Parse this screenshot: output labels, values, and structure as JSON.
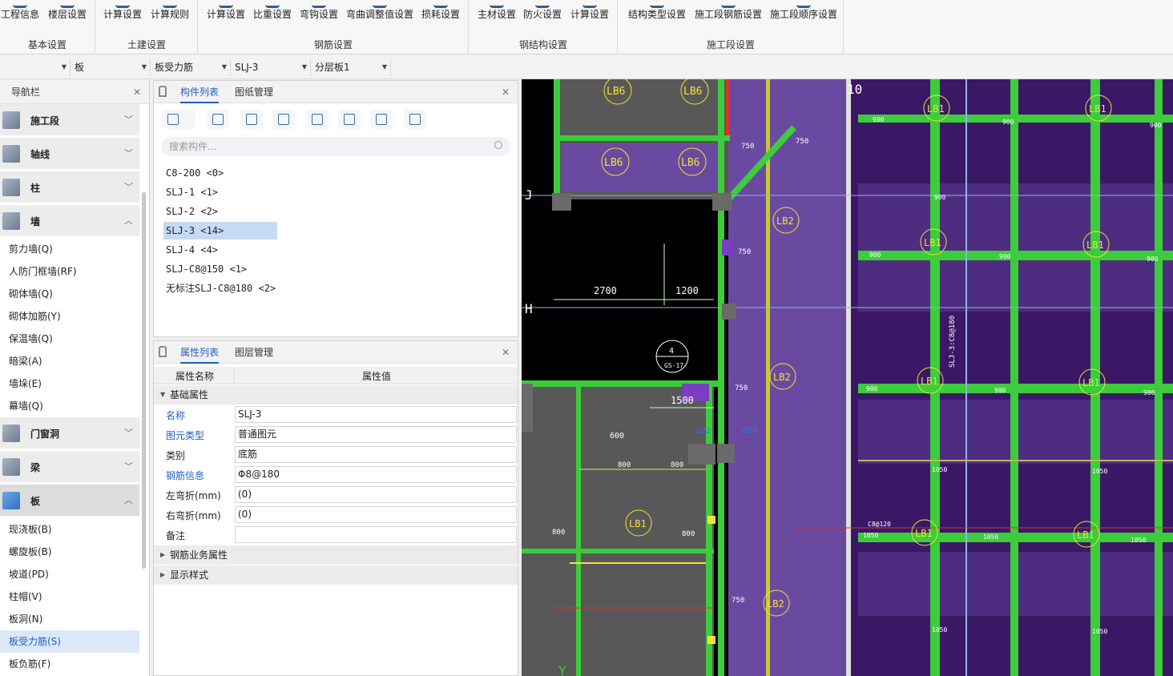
{
  "ribbon": {
    "groups": [
      {
        "label": "基本设置",
        "buttons": [
          "工程信息",
          "楼层设置"
        ]
      },
      {
        "label": "土建设置",
        "buttons": [
          "计算设置",
          "计算规则"
        ]
      },
      {
        "label": "钢筋设置",
        "buttons": [
          "计算设置",
          "比重设置",
          "弯钩设置",
          "弯曲调整值设置",
          "损耗设置"
        ]
      },
      {
        "label": "钢结构设置",
        "buttons": [
          "主材设置",
          "防火设置",
          "计算设置"
        ]
      },
      {
        "label": "施工段设置",
        "buttons": [
          "结构类型设置",
          "施工段钢筋设置",
          "施工段顺序设置"
        ]
      }
    ]
  },
  "filterbar": {
    "category": "板",
    "type": "板受力筋",
    "component": "SLJ-3",
    "layer": "分层板1"
  },
  "nav": {
    "title": "导航栏",
    "categories": [
      "施工段",
      "轴线",
      "柱",
      "墙",
      "门窗洞",
      "梁",
      "板"
    ],
    "wall_items": [
      "剪力墙(Q)",
      "人防门框墙(RF)",
      "砌体墙(Q)",
      "砌体加筋(Y)",
      "保温墙(Q)",
      "暗梁(A)",
      "墙垛(E)",
      "幕墙(Q)"
    ],
    "slab_items": [
      "现浇板(B)",
      "螺旋板(B)",
      "坡道(PD)",
      "柱帽(V)",
      "板洞(N)",
      "板受力筋(S)",
      "板负筋(F)"
    ]
  },
  "component_panel": {
    "tabs": [
      "构件列表",
      "图纸管理"
    ],
    "search_placeholder": "搜索构件...",
    "items": [
      "C8-200 <0>",
      "SLJ-1 <1>",
      "SLJ-2 <2>",
      "SLJ-3 <14>",
      "SLJ-4 <4>",
      "SLJ-C8@150 <1>",
      "无标注SLJ-C8@180 <2>"
    ],
    "selected_index": 3
  },
  "property_panel": {
    "tabs": [
      "属性列表",
      "图层管理"
    ],
    "col_name": "属性名称",
    "col_value": "属性值",
    "group_basic": "基础属性",
    "rows": [
      {
        "key": "名称",
        "value": "SLJ-3",
        "blue": true
      },
      {
        "key": "图元类型",
        "value": "普通图元",
        "blue": true
      },
      {
        "key": "类别",
        "value": "底筋",
        "blue": false
      },
      {
        "key": "钢筋信息",
        "value": "Φ8@180",
        "blue": true
      },
      {
        "key": "左弯折(mm)",
        "value": "(0)",
        "blue": false
      },
      {
        "key": "右弯折(mm)",
        "value": "(0)",
        "blue": false
      },
      {
        "key": "备注",
        "value": "",
        "blue": false
      }
    ],
    "group_rebar": "钢筋业务属性",
    "group_display": "显示样式"
  },
  "drawing": {
    "grid_labels": [
      "J",
      "H",
      "10",
      "Y"
    ],
    "slab_labels": [
      "LB6",
      "LB6",
      "LB6",
      "LB6",
      "LB1",
      "LB1",
      "LB1",
      "LB1",
      "LB1",
      "LB1",
      "LB1",
      "LB1",
      "LB2",
      "LB2",
      "LB2",
      "LB1"
    ],
    "dims": [
      "2700",
      "1200",
      "1500",
      "600",
      "800",
      "800",
      "800",
      "800",
      "750",
      "750",
      "750",
      "750",
      "750",
      "900",
      "900",
      "900",
      "900",
      "900",
      "900",
      "900",
      "900",
      "900",
      "900",
      "1050",
      "1050",
      "1050",
      "1050",
      "1050",
      "1050",
      "1050"
    ],
    "annotations": [
      "SLJ-3:C8@180",
      "C8@120",
      "GZ2",
      "GZ2",
      "GS-17",
      "4"
    ],
    "colors": {
      "bg": "#000000",
      "slab": "#5b2d8e",
      "slab_dark": "#3a1866",
      "beam": "#3ccc3c",
      "grid": "#8fb4e8",
      "column": "#6a6a6a",
      "accent": "#f5e03a",
      "red": "#e0302a"
    }
  }
}
